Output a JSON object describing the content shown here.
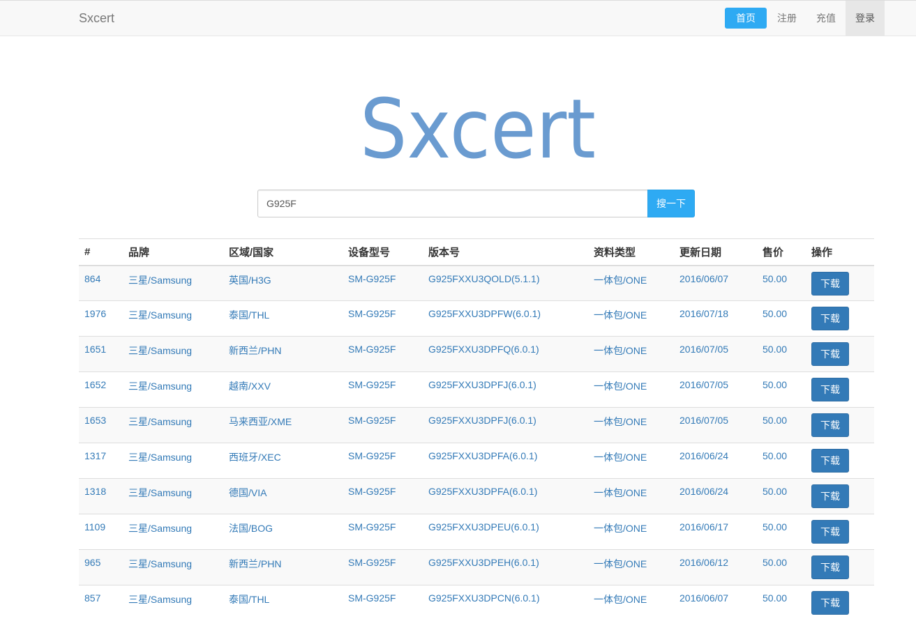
{
  "navbar": {
    "brand": "Sxcert",
    "items": [
      {
        "label": "首页"
      },
      {
        "label": "注册"
      },
      {
        "label": "充值"
      },
      {
        "label": "登录"
      }
    ]
  },
  "logo": {
    "text": "Sxcert",
    "color": "#6a9bd0"
  },
  "search": {
    "value": "G925F",
    "button_label": "搜一下"
  },
  "table": {
    "headers": [
      "#",
      "品牌",
      "区域/国家",
      "设备型号",
      "版本号",
      "资料类型",
      "更新日期",
      "售价",
      "操作"
    ],
    "rows": [
      {
        "id": "864",
        "brand": "三星/Samsung",
        "region": "英国/H3G",
        "model": "SM-G925F",
        "version": "G925FXXU3QOLD(5.1.1)",
        "type": "一体包/ONE",
        "date": "2016/06/07",
        "price": "50.00",
        "action": "下载"
      },
      {
        "id": "1976",
        "brand": "三星/Samsung",
        "region": "泰国/THL",
        "model": "SM-G925F",
        "version": "G925FXXU3DPFW(6.0.1)",
        "type": "一体包/ONE",
        "date": "2016/07/18",
        "price": "50.00",
        "action": "下载"
      },
      {
        "id": "1651",
        "brand": "三星/Samsung",
        "region": "新西兰/PHN",
        "model": "SM-G925F",
        "version": "G925FXXU3DPFQ(6.0.1)",
        "type": "一体包/ONE",
        "date": "2016/07/05",
        "price": "50.00",
        "action": "下载"
      },
      {
        "id": "1652",
        "brand": "三星/Samsung",
        "region": "越南/XXV",
        "model": "SM-G925F",
        "version": "G925FXXU3DPFJ(6.0.1)",
        "type": "一体包/ONE",
        "date": "2016/07/05",
        "price": "50.00",
        "action": "下载"
      },
      {
        "id": "1653",
        "brand": "三星/Samsung",
        "region": "马来西亚/XME",
        "model": "SM-G925F",
        "version": "G925FXXU3DPFJ(6.0.1)",
        "type": "一体包/ONE",
        "date": "2016/07/05",
        "price": "50.00",
        "action": "下载"
      },
      {
        "id": "1317",
        "brand": "三星/Samsung",
        "region": "西班牙/XEC",
        "model": "SM-G925F",
        "version": "G925FXXU3DPFA(6.0.1)",
        "type": "一体包/ONE",
        "date": "2016/06/24",
        "price": "50.00",
        "action": "下载"
      },
      {
        "id": "1318",
        "brand": "三星/Samsung",
        "region": "德国/VIA",
        "model": "SM-G925F",
        "version": "G925FXXU3DPFA(6.0.1)",
        "type": "一体包/ONE",
        "date": "2016/06/24",
        "price": "50.00",
        "action": "下载"
      },
      {
        "id": "1109",
        "brand": "三星/Samsung",
        "region": "法国/BOG",
        "model": "SM-G925F",
        "version": "G925FXXU3DPEU(6.0.1)",
        "type": "一体包/ONE",
        "date": "2016/06/17",
        "price": "50.00",
        "action": "下载"
      },
      {
        "id": "965",
        "brand": "三星/Samsung",
        "region": "新西兰/PHN",
        "model": "SM-G925F",
        "version": "G925FXXU3DPEH(6.0.1)",
        "type": "一体包/ONE",
        "date": "2016/06/12",
        "price": "50.00",
        "action": "下载"
      },
      {
        "id": "857",
        "brand": "三星/Samsung",
        "region": "泰国/THL",
        "model": "SM-G925F",
        "version": "G925FXXU3DPCN(6.0.1)",
        "type": "一体包/ONE",
        "date": "2016/06/07",
        "price": "50.00",
        "action": "下载"
      }
    ]
  }
}
